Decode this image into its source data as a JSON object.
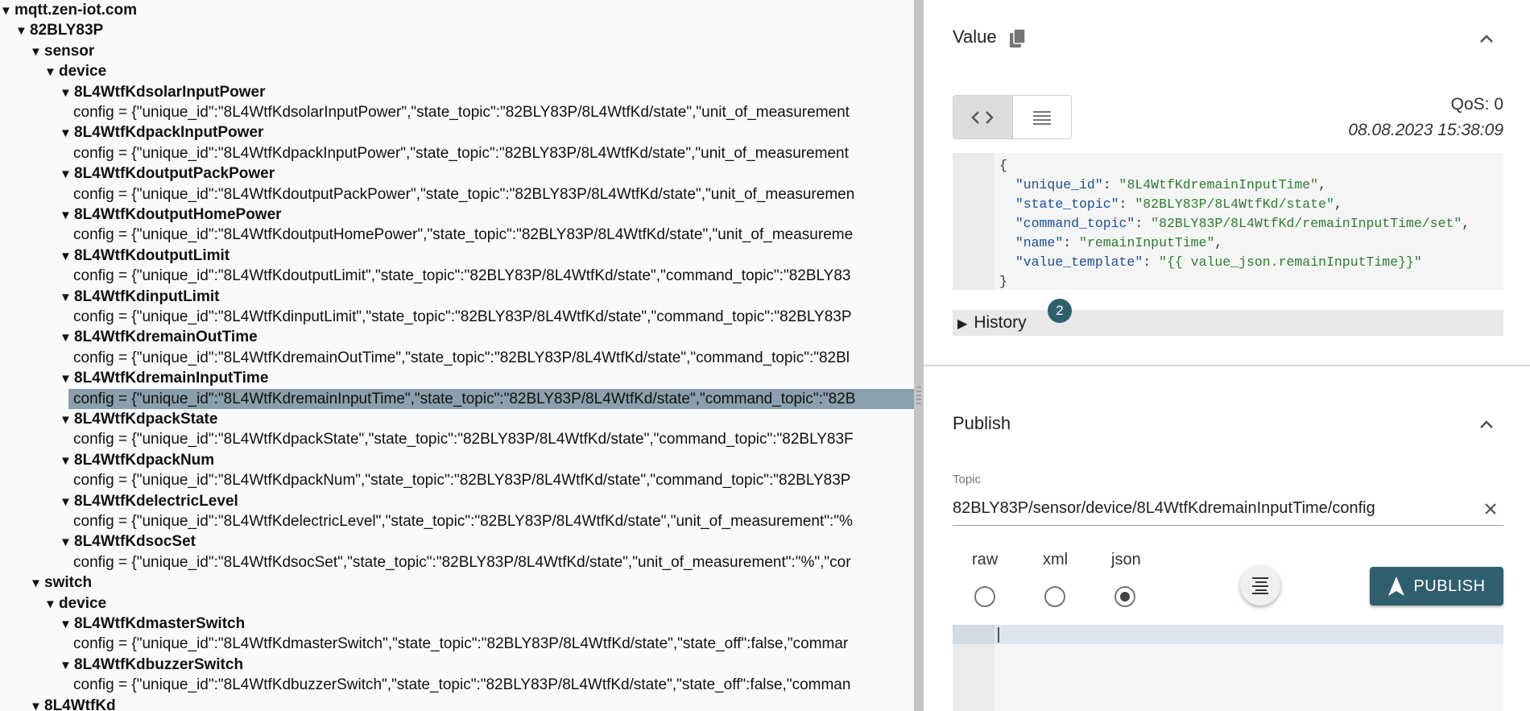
{
  "tree": {
    "root": "mqtt.zen-iot.com",
    "l1": "82BLY83P",
    "sensor": "sensor",
    "sensor_device": "device",
    "sensor_entities": [
      {
        "name": "8L4WtfKdsolarInputPower",
        "config": "config = {\"unique_id\":\"8L4WtfKdsolarInputPower\",\"state_topic\":\"82BLY83P/8L4WtfKd/state\",\"unit_of_measurement"
      },
      {
        "name": "8L4WtfKdpackInputPower",
        "config": "config = {\"unique_id\":\"8L4WtfKdpackInputPower\",\"state_topic\":\"82BLY83P/8L4WtfKd/state\",\"unit_of_measurement"
      },
      {
        "name": "8L4WtfKdoutputPackPower",
        "config": "config = {\"unique_id\":\"8L4WtfKdoutputPackPower\",\"state_topic\":\"82BLY83P/8L4WtfKd/state\",\"unit_of_measuremen"
      },
      {
        "name": "8L4WtfKdoutputHomePower",
        "config": "config = {\"unique_id\":\"8L4WtfKdoutputHomePower\",\"state_topic\":\"82BLY83P/8L4WtfKd/state\",\"unit_of_measureme"
      },
      {
        "name": "8L4WtfKdoutputLimit",
        "config": "config = {\"unique_id\":\"8L4WtfKdoutputLimit\",\"state_topic\":\"82BLY83P/8L4WtfKd/state\",\"command_topic\":\"82BLY83"
      },
      {
        "name": "8L4WtfKdinputLimit",
        "config": "config = {\"unique_id\":\"8L4WtfKdinputLimit\",\"state_topic\":\"82BLY83P/8L4WtfKd/state\",\"command_topic\":\"82BLY83P"
      },
      {
        "name": "8L4WtfKdremainOutTime",
        "config": "config = {\"unique_id\":\"8L4WtfKdremainOutTime\",\"state_topic\":\"82BLY83P/8L4WtfKd/state\",\"command_topic\":\"82Bl"
      },
      {
        "name": "8L4WtfKdremainInputTime",
        "config": "config = {\"unique_id\":\"8L4WtfKdremainInputTime\",\"state_topic\":\"82BLY83P/8L4WtfKd/state\",\"command_topic\":\"82B"
      },
      {
        "name": "8L4WtfKdpackState",
        "config": "config = {\"unique_id\":\"8L4WtfKdpackState\",\"state_topic\":\"82BLY83P/8L4WtfKd/state\",\"command_topic\":\"82BLY83F"
      },
      {
        "name": "8L4WtfKdpackNum",
        "config": "config = {\"unique_id\":\"8L4WtfKdpackNum\",\"state_topic\":\"82BLY83P/8L4WtfKd/state\",\"command_topic\":\"82BLY83P"
      },
      {
        "name": "8L4WtfKdelectricLevel",
        "config": "config = {\"unique_id\":\"8L4WtfKdelectricLevel\",\"state_topic\":\"82BLY83P/8L4WtfKd/state\",\"unit_of_measurement\":\"%"
      },
      {
        "name": "8L4WtfKdsocSet",
        "config": "config = {\"unique_id\":\"8L4WtfKdsocSet\",\"state_topic\":\"82BLY83P/8L4WtfKd/state\",\"unit_of_measurement\":\"%\",\"cor"
      }
    ],
    "switch": "switch",
    "switch_device": "device",
    "switch_entities": [
      {
        "name": "8L4WtfKdmasterSwitch",
        "config": "config = {\"unique_id\":\"8L4WtfKdmasterSwitch\",\"state_topic\":\"82BLY83P/8L4WtfKd/state\",\"state_off\":false,\"commar"
      },
      {
        "name": "8L4WtfKdbuzzerSwitch",
        "config": "config = {\"unique_id\":\"8L4WtfKdbuzzerSwitch\",\"state_topic\":\"82BLY83P/8L4WtfKd/state\",\"state_off\":false,\"comman"
      }
    ],
    "next_node": "8L4WtfKd",
    "selected_index": 7,
    "arrow": "▼"
  },
  "value": {
    "title": "Value",
    "qos": "QoS: 0",
    "timestamp": "08.08.2023 15:38:09",
    "history_label": "History",
    "history_count": "2",
    "json_lines": [
      {
        "t": "brace",
        "text": "{"
      },
      {
        "t": "kv",
        "key": "\"unique_id\"",
        "val": "\"8L4WtfKdremainInputTime\"",
        "end": ","
      },
      {
        "t": "kv",
        "key": "\"state_topic\"",
        "val": "\"82BLY83P/8L4WtfKd/state\"",
        "end": ","
      },
      {
        "t": "kv",
        "key": "\"command_topic\"",
        "val": "\"82BLY83P/8L4WtfKd/remainInputTime/set\"",
        "end": ","
      },
      {
        "t": "kv",
        "key": "\"name\"",
        "val": "\"remainInputTime\"",
        "end": ","
      },
      {
        "t": "kv",
        "key": "\"value_template\"",
        "val": "\"{{ value_json.remainInputTime}}\"",
        "end": ""
      },
      {
        "t": "brace",
        "text": "}"
      }
    ]
  },
  "publish": {
    "title": "Publish",
    "topic_label": "Topic",
    "topic_value": "82BLY83P/sensor/device/8L4WtfKdremainInputTime/config",
    "formats": [
      "raw",
      "xml",
      "json"
    ],
    "selected_format": "json",
    "button_label": "PUBLISH"
  },
  "colors": {
    "accent": "#2f5f6e",
    "selection": "#8aa0ac",
    "json_key": "#1a4f9c",
    "json_string": "#2e7d32"
  },
  "icons": [
    "copy-icon",
    "chevron-up-icon",
    "code-view-icon",
    "raw-view-icon",
    "history-expand-icon",
    "clear-icon",
    "format-icon",
    "send-icon"
  ]
}
